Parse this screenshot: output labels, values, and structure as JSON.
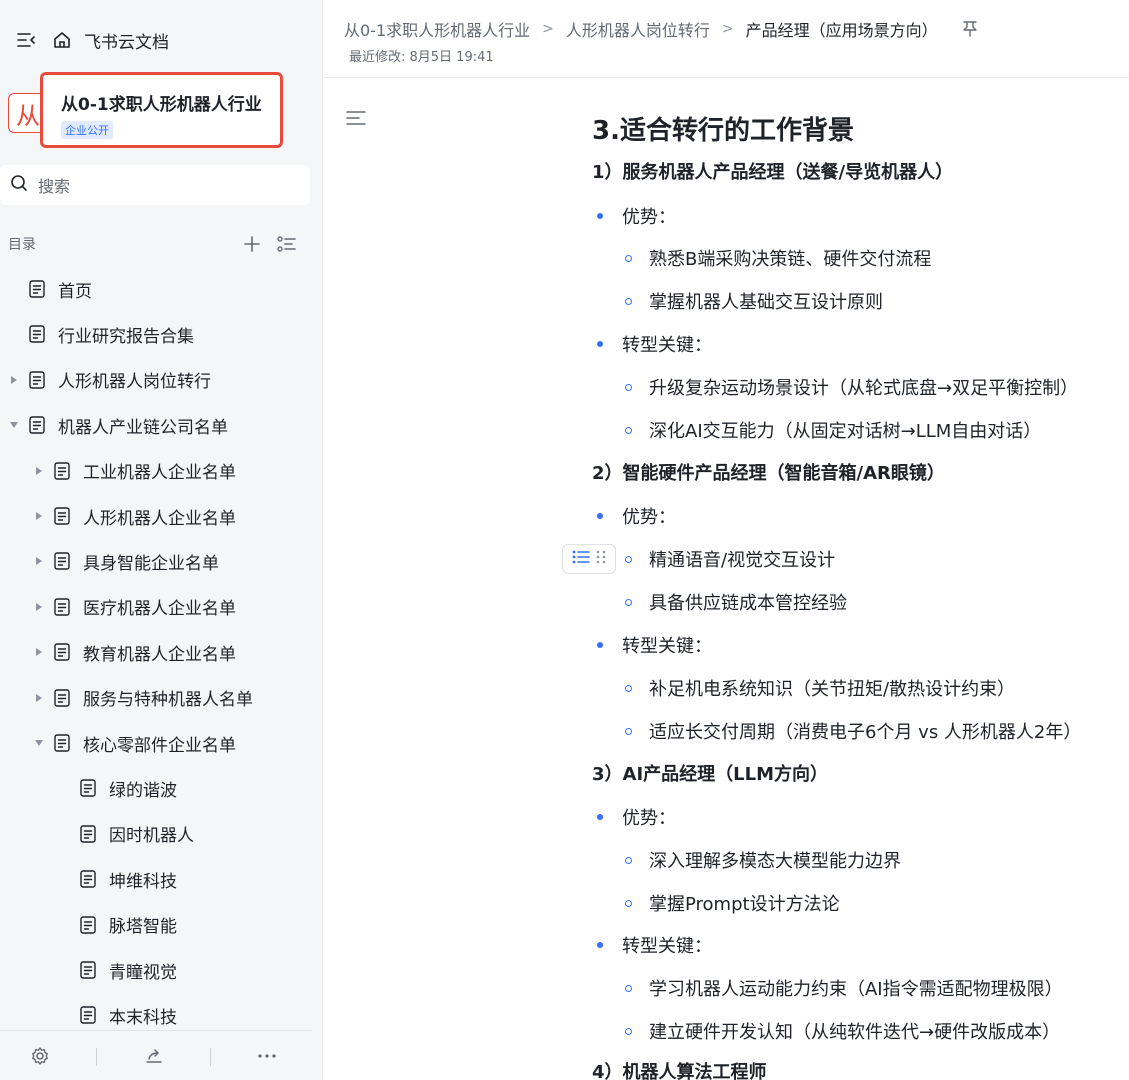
{
  "app": {
    "brand": "飞书云文档"
  },
  "space": {
    "logo_char": "从",
    "title": "从0-1求职人形机器人行业",
    "badge": "企业公开"
  },
  "search": {
    "placeholder": "搜索"
  },
  "toc": {
    "label": "目录",
    "items": [
      {
        "label": "首页",
        "level": 0,
        "arrow": "none"
      },
      {
        "label": "行业研究报告合集",
        "level": 0,
        "arrow": "none"
      },
      {
        "label": "人形机器人岗位转行",
        "level": 0,
        "arrow": "collapsed"
      },
      {
        "label": "机器人产业链公司名单",
        "level": 0,
        "arrow": "expanded"
      },
      {
        "label": "工业机器人企业名单",
        "level": 1,
        "arrow": "collapsed"
      },
      {
        "label": "人形机器人企业名单",
        "level": 1,
        "arrow": "collapsed"
      },
      {
        "label": "具身智能企业名单",
        "level": 1,
        "arrow": "collapsed"
      },
      {
        "label": "医疗机器人企业名单",
        "level": 1,
        "arrow": "collapsed"
      },
      {
        "label": "教育机器人企业名单",
        "level": 1,
        "arrow": "collapsed"
      },
      {
        "label": "服务与特种机器人名单",
        "level": 1,
        "arrow": "collapsed"
      },
      {
        "label": "核心零部件企业名单",
        "level": 1,
        "arrow": "expanded"
      },
      {
        "label": "绿的谐波",
        "level": 2,
        "arrow": "none"
      },
      {
        "label": "因时机器人",
        "level": 2,
        "arrow": "none"
      },
      {
        "label": "坤维科技",
        "level": 2,
        "arrow": "none"
      },
      {
        "label": "脉塔智能",
        "level": 2,
        "arrow": "none"
      },
      {
        "label": "青瞳视觉",
        "level": 2,
        "arrow": "none"
      },
      {
        "label": "本末科技",
        "level": 2,
        "arrow": "none"
      }
    ]
  },
  "breadcrumb": {
    "items": [
      "从0-1求职人形机器人行业",
      "人形机器人岗位转行",
      "产品经理（应用场景方向）"
    ],
    "separator": ">"
  },
  "modified": "最近修改: 8月5日 19:41",
  "document": {
    "heading": "3.适合转行的工作背景",
    "blocks": [
      {
        "type": "h3",
        "text": "1）服务机器人产品经理（送餐/导览机器人）"
      },
      {
        "type": "li1",
        "text": "优势："
      },
      {
        "type": "li2",
        "text": "熟悉B端采购决策链、硬件交付流程"
      },
      {
        "type": "li2",
        "text": "掌握机器人基础交互设计原则"
      },
      {
        "type": "li1",
        "text": "转型关键："
      },
      {
        "type": "li2",
        "text": "升级复杂运动场景设计（从轮式底盘→双足平衡控制）"
      },
      {
        "type": "li2",
        "text": "深化AI交互能力（从固定对话树→LLM自由对话）"
      },
      {
        "type": "h3",
        "text": "2）智能硬件产品经理（智能音箱/AR眼镜）"
      },
      {
        "type": "li1",
        "text": "优势："
      },
      {
        "type": "li2",
        "text": "精通语音/视觉交互设计"
      },
      {
        "type": "li2",
        "text": "具备供应链成本管控经验"
      },
      {
        "type": "li1",
        "text": "转型关键："
      },
      {
        "type": "li2",
        "text": "补足机电系统知识（关节扭矩/散热设计约束）"
      },
      {
        "type": "li2",
        "text": "适应长交付周期（消费电子6个月 vs 人形机器人2年）"
      },
      {
        "type": "h3",
        "text": "3）AI产品经理（LLM方向）"
      },
      {
        "type": "li1",
        "text": "优势："
      },
      {
        "type": "li2",
        "text": "深入理解多模态大模型能力边界"
      },
      {
        "type": "li2",
        "text": "掌握Prompt设计方法论"
      },
      {
        "type": "li1",
        "text": "转型关键："
      },
      {
        "type": "li2",
        "text": "学习机器人运动能力约束（AI指令需适配物理极限）"
      },
      {
        "type": "li2",
        "text": "建立硬件开发认知（从纯软件迭代→硬件改版成本）"
      },
      {
        "type": "h3",
        "text": "4）机器人算法工程师"
      }
    ]
  },
  "colors": {
    "accent": "#3370ff",
    "highlight_border": "#e84a3c",
    "sidebar_bg": "#f5f6f7"
  }
}
